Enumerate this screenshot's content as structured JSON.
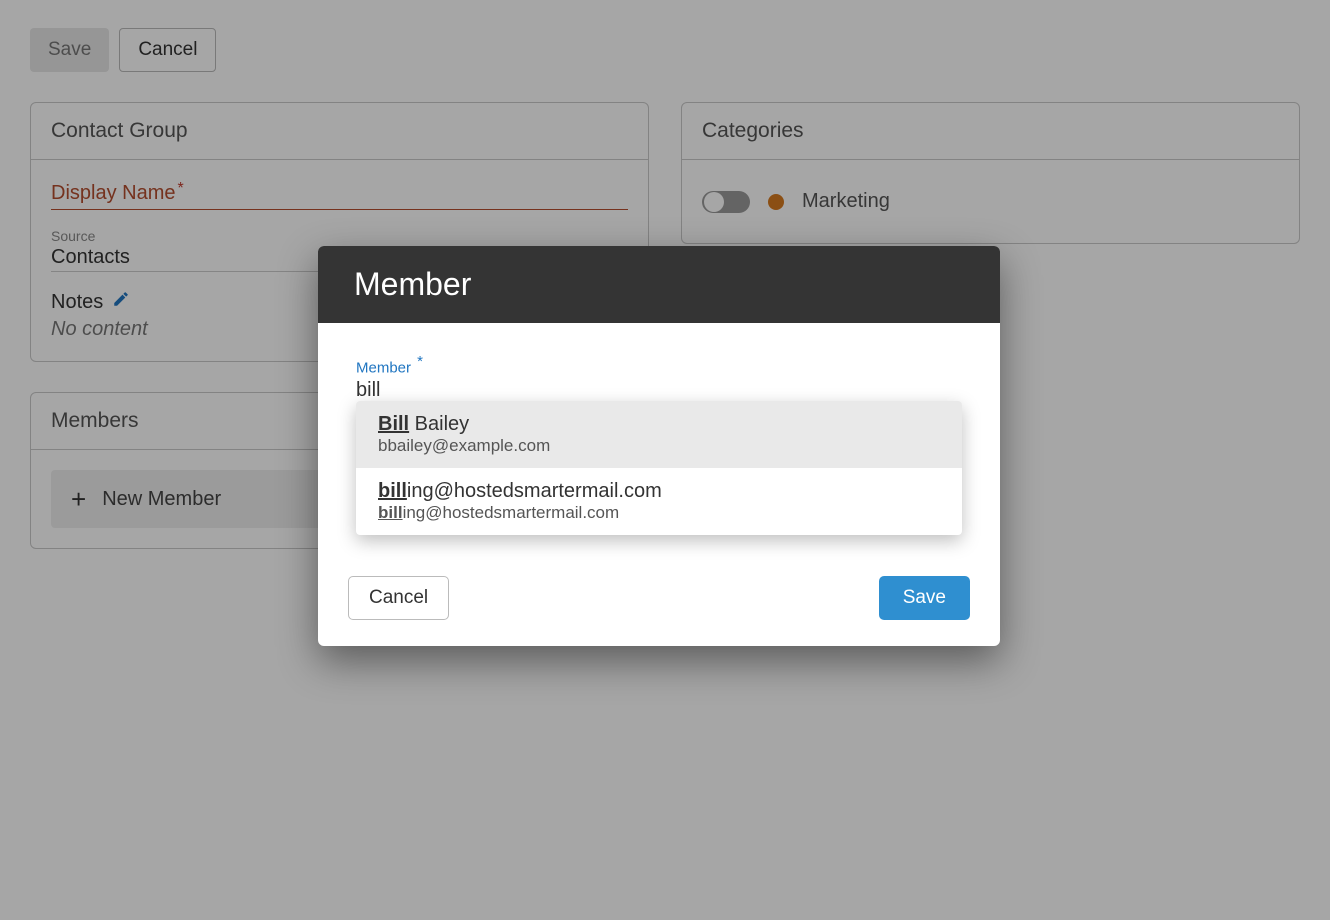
{
  "toolbar": {
    "save_label": "Save",
    "cancel_label": "Cancel"
  },
  "contact_group": {
    "panel_title": "Contact Group",
    "display_name_label": "Display Name",
    "source_label": "Source",
    "source_value": "Contacts",
    "notes_label": "Notes",
    "no_content": "No content"
  },
  "members": {
    "panel_title": "Members",
    "new_member_label": "New Member"
  },
  "categories": {
    "panel_title": "Categories",
    "items": [
      {
        "label": "Marketing"
      }
    ]
  },
  "modal": {
    "title": "Member",
    "field_label": "Member",
    "input_value": "bill",
    "cancel_label": "Cancel",
    "save_label": "Save",
    "suggestions": [
      {
        "primary_match": "Bill",
        "primary_rest": " Bailey",
        "secondary_match": "",
        "secondary_rest": "bbailey@example.com",
        "highlight": true
      },
      {
        "primary_match": "bill",
        "primary_rest": "ing@hostedsmartermail.com",
        "secondary_match": "bill",
        "secondary_rest": "ing@hostedsmartermail.com",
        "highlight": false
      }
    ]
  }
}
